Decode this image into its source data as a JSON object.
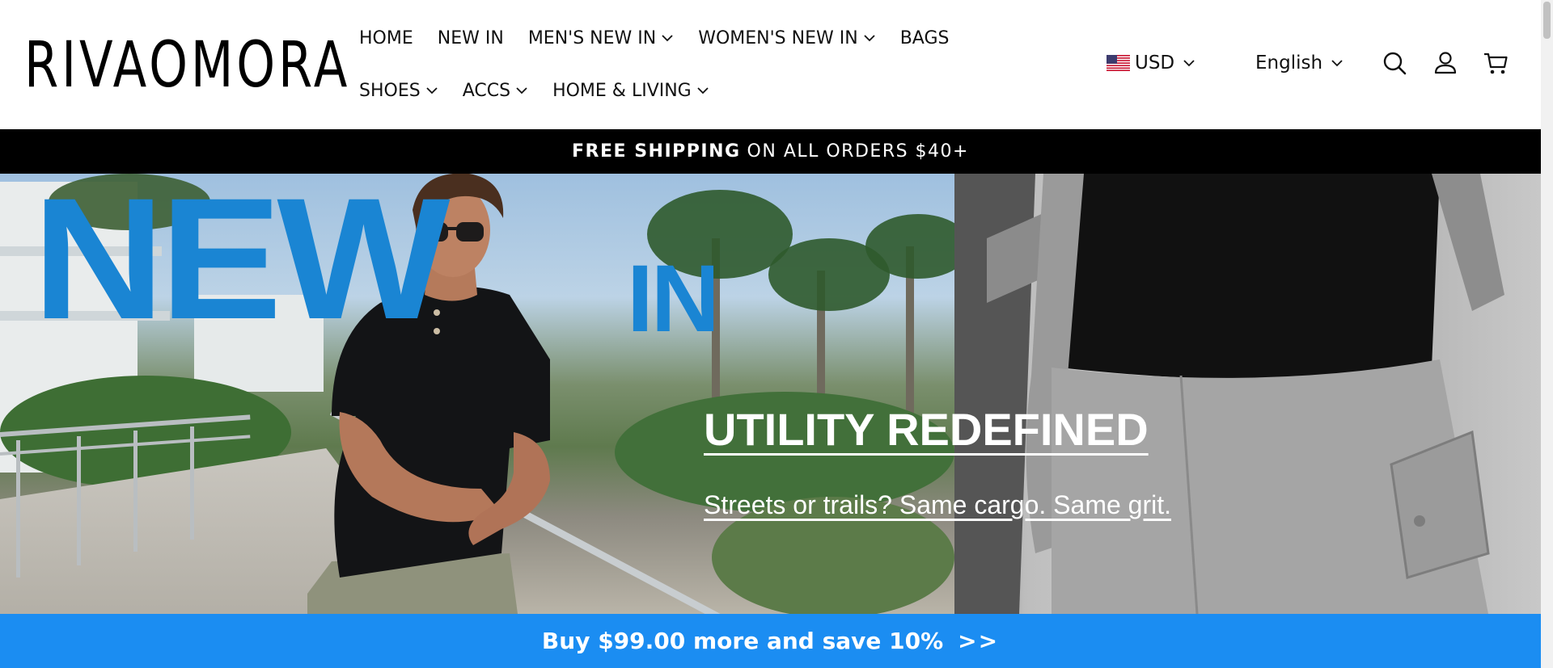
{
  "brand": {
    "logo_text": "RIVAOMORA"
  },
  "nav": {
    "row1": [
      {
        "label": "HOME",
        "dropdown": false
      },
      {
        "label": "NEW IN",
        "dropdown": false
      },
      {
        "label": "MEN'S NEW IN",
        "dropdown": true
      },
      {
        "label": "WOMEN'S NEW IN",
        "dropdown": true
      },
      {
        "label": "BAGS",
        "dropdown": false
      }
    ],
    "row2": [
      {
        "label": "SHOES",
        "dropdown": true
      },
      {
        "label": "ACCS",
        "dropdown": true
      },
      {
        "label": "HOME & LIVING",
        "dropdown": true
      }
    ]
  },
  "header_controls": {
    "currency": "USD",
    "language": "English",
    "icons": [
      "search-icon",
      "account-icon",
      "cart-icon"
    ]
  },
  "shipping_bar": {
    "bold": "FREE SHIPPING",
    "rest": "ON ALL ORDERS $40+"
  },
  "hero": {
    "big_word_1": "NEW",
    "big_word_2": "IN",
    "headline": "UTILITY REDEFINED",
    "subline": "Streets or trails? Same cargo. Same grit.",
    "accent_color": "#1a85d3"
  },
  "promo_bar": {
    "text": "Buy $99.00 more and save 10%",
    "arrow": ">>",
    "color": "#1b8df2"
  }
}
